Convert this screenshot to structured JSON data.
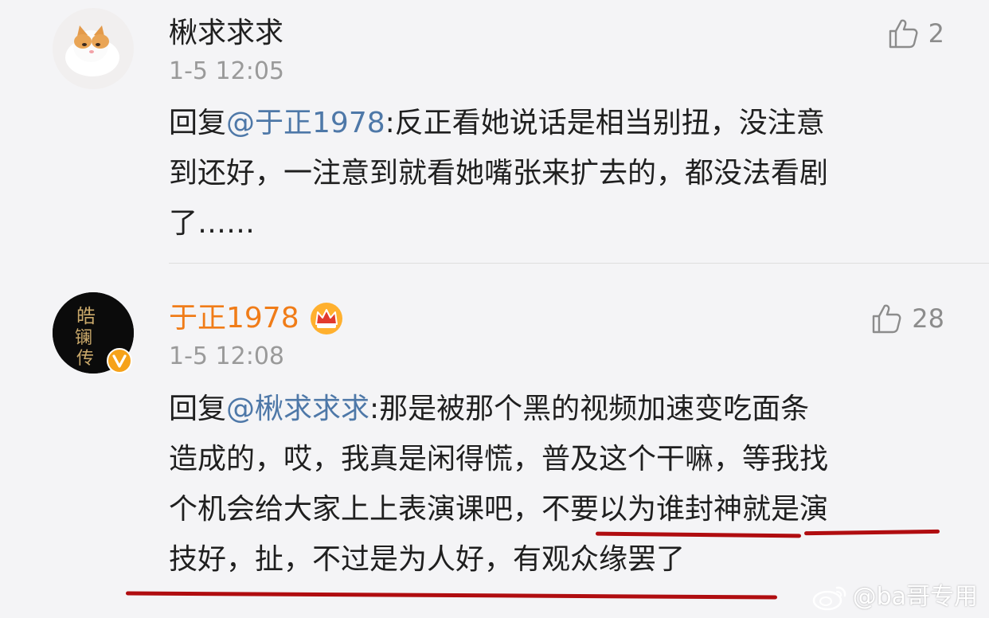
{
  "comments": [
    {
      "username": "楸求求求",
      "timestamp": "1-5 12:05",
      "like_count": "2",
      "reply_prefix": "回复",
      "mention": "@于正1978",
      "lines": [
        ":反正看她说话是相当别扭，没注意",
        "到还好，一注意到就看她嘴张来扩去的，都没法看剧",
        "了……"
      ]
    },
    {
      "username": "于正1978",
      "timestamp": "1-5 12:08",
      "like_count": "28",
      "reply_prefix": "回复",
      "mention": "@楸求求求",
      "lines": [
        ":那是被那个黑的视频加速变吃面条",
        "造成的，哎，我真是闲得慌，普及这个干嘛，等我找",
        "个机会给大家上上表演课吧，不要以为谁封神就是演",
        "技好，扯，不过是为人好，有观众缘罢了"
      ]
    }
  ],
  "watermark": "@ba哥专用",
  "colors": {
    "mention": "#4e78a8",
    "vip_name": "#f07c18",
    "underline": "#b00d10",
    "timestamp": "#9a9a9a"
  }
}
